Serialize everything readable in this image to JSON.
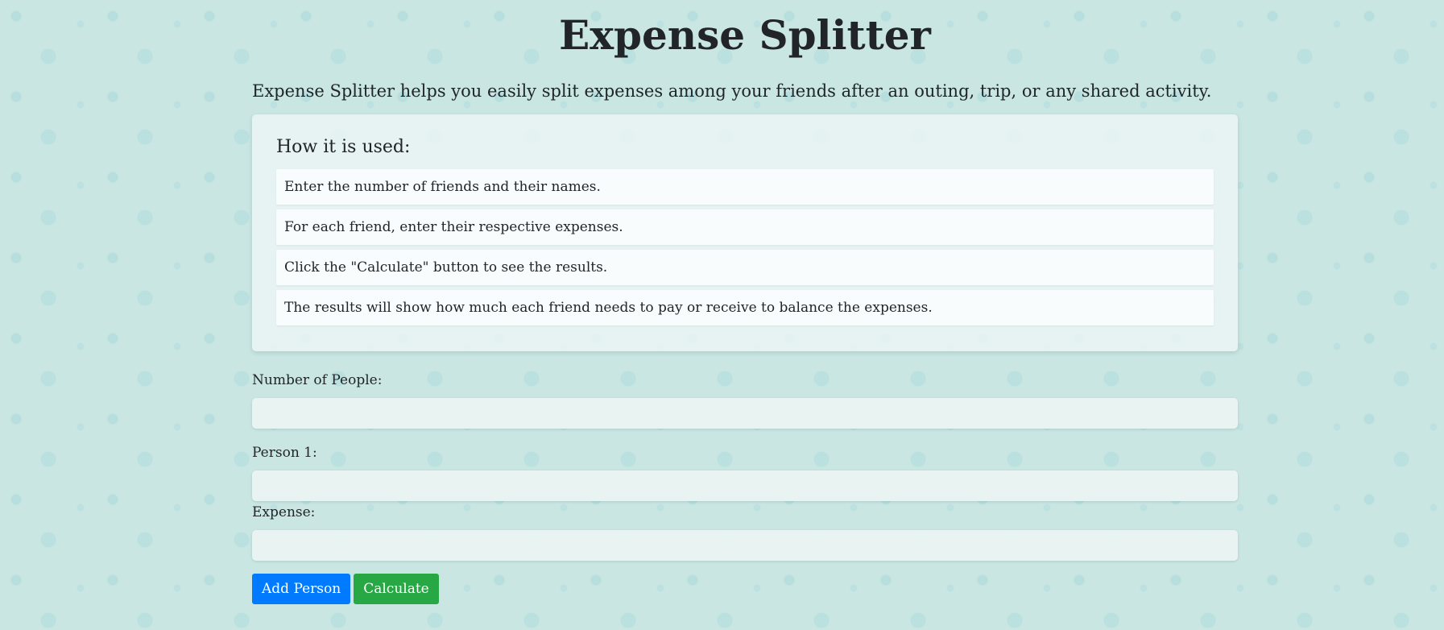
{
  "header": {
    "title": "Expense Splitter",
    "intro": "Expense Splitter helps you easily split expenses among your friends after an outing, trip, or any shared activity."
  },
  "instructions": {
    "heading": "How it is used:",
    "steps": [
      "Enter the number of friends and their names.",
      "For each friend, enter their respective expenses.",
      "Click the \"Calculate\" button to see the results.",
      "The results will show how much each friend needs to pay or receive to balance the expenses."
    ]
  },
  "form": {
    "people_label": "Number of People:",
    "people_value": "",
    "person_label": "Person 1:",
    "person_value": "",
    "expense_label": "Expense:",
    "expense_value": ""
  },
  "buttons": {
    "add_person": "Add Person",
    "calculate": "Calculate"
  },
  "colors": {
    "background": "#c9e6e3",
    "add_button": "#007bff",
    "calculate_button": "#28a745"
  }
}
